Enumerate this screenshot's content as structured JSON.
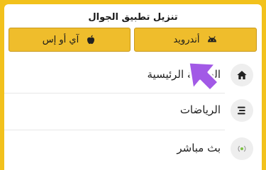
{
  "header": {
    "title": "تنزيل تطبيق الجوال"
  },
  "download_buttons": {
    "android": {
      "label": "أندرويد",
      "icon": "android-icon"
    },
    "ios": {
      "label": "آي أو إس",
      "icon": "apple-icon"
    }
  },
  "menu": {
    "items": [
      {
        "label": "الصفحة الرئيسية",
        "icon": "home-icon"
      },
      {
        "label": "الرياضات",
        "icon": "sports-list-icon"
      },
      {
        "label": "بث مباشر",
        "icon": "live-broadcast-icon"
      }
    ]
  },
  "colors": {
    "frame": "#f2c11c",
    "button": "#efbd2c",
    "pointer": "#a259e6",
    "live_dot": "#7cc243"
  }
}
